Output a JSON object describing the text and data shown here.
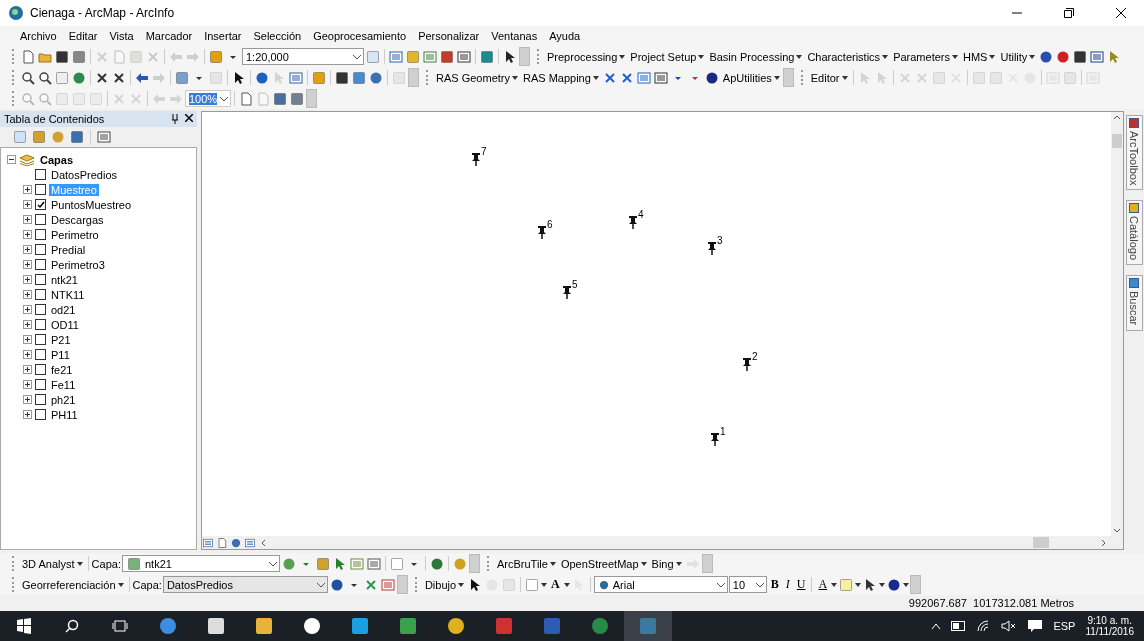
{
  "window": {
    "title": "Cienaga - ArcMap - ArcInfo"
  },
  "menu": [
    "Archivo",
    "Editar",
    "Vista",
    "Marcador",
    "Insertar",
    "Selección",
    "Geoprocesamiento",
    "Personalizar",
    "Ventanas",
    "Ayuda"
  ],
  "toolbar_1": {
    "scale": "1:20,000",
    "menus": [
      "Preprocessing",
      "Project Setup",
      "Basin Processing",
      "Characteristics",
      "Parameters",
      "HMS",
      "Utility"
    ]
  },
  "toolbar_2": {
    "menus": [
      "RAS Geometry",
      "RAS Mapping"
    ],
    "utilities_menu": "ApUtilities",
    "editor_menu": "Editor"
  },
  "toolbar_3": {
    "zoom": "100%"
  },
  "toc": {
    "title": "Tabla de Contenidos",
    "group": {
      "label": "Capas",
      "expanded": true,
      "children": [
        {
          "label": "DatosPredios",
          "expandable": false,
          "checked": false,
          "selected": false
        },
        {
          "label": "Muestreo",
          "expandable": true,
          "checked": false,
          "selected": true
        },
        {
          "label": "PuntosMuestreo",
          "expandable": true,
          "checked": true,
          "selected": false
        },
        {
          "label": "Descargas",
          "expandable": true,
          "checked": false,
          "selected": false
        },
        {
          "label": "Perimetro",
          "expandable": true,
          "checked": false,
          "selected": false
        },
        {
          "label": "Predial",
          "expandable": true,
          "checked": false,
          "selected": false
        },
        {
          "label": "Perimetro3",
          "expandable": true,
          "checked": false,
          "selected": false
        },
        {
          "label": "ntk21",
          "expandable": true,
          "checked": false,
          "selected": false
        },
        {
          "label": "NTK11",
          "expandable": true,
          "checked": false,
          "selected": false
        },
        {
          "label": "od21",
          "expandable": true,
          "checked": false,
          "selected": false
        },
        {
          "label": "OD11",
          "expandable": true,
          "checked": false,
          "selected": false
        },
        {
          "label": "P21",
          "expandable": true,
          "checked": false,
          "selected": false
        },
        {
          "label": "P11",
          "expandable": true,
          "checked": false,
          "selected": false
        },
        {
          "label": "fe21",
          "expandable": true,
          "checked": false,
          "selected": false
        },
        {
          "label": "Fe11",
          "expandable": true,
          "checked": false,
          "selected": false
        },
        {
          "label": "ph21",
          "expandable": true,
          "checked": false,
          "selected": false
        },
        {
          "label": "PH11",
          "expandable": true,
          "checked": false,
          "selected": false
        }
      ]
    }
  },
  "map": {
    "points": [
      {
        "label": "7"
      },
      {
        "label": "6"
      },
      {
        "label": "4"
      },
      {
        "label": "3"
      },
      {
        "label": "5"
      },
      {
        "label": "2"
      },
      {
        "label": "1"
      }
    ]
  },
  "dock_tabs": [
    "ArcToolbox",
    "Catálogo",
    "Buscar"
  ],
  "bottom_toolbar_1": {
    "menu": "3D Analyst",
    "layer_label": "Capa:",
    "layer": "ntk21",
    "menus": [
      "ArcBruTile",
      "OpenStreetMap",
      "Bing"
    ]
  },
  "bottom_toolbar_2": {
    "menu": "Georreferenciación",
    "layer_label": "Capa:",
    "layer": "DatosPredios",
    "draw_menu": "Dibujo",
    "text_tool": "A",
    "font": "Arial",
    "font_size": "10",
    "bold": "B",
    "italic": "I",
    "underline": "U",
    "font_color": "A"
  },
  "status_bar": {
    "coordinates": "992067.687  1017312.081 Metros"
  },
  "taskbar": {
    "language": "ESP",
    "time": "9:10 a. m.",
    "date": "11/11/2016"
  }
}
